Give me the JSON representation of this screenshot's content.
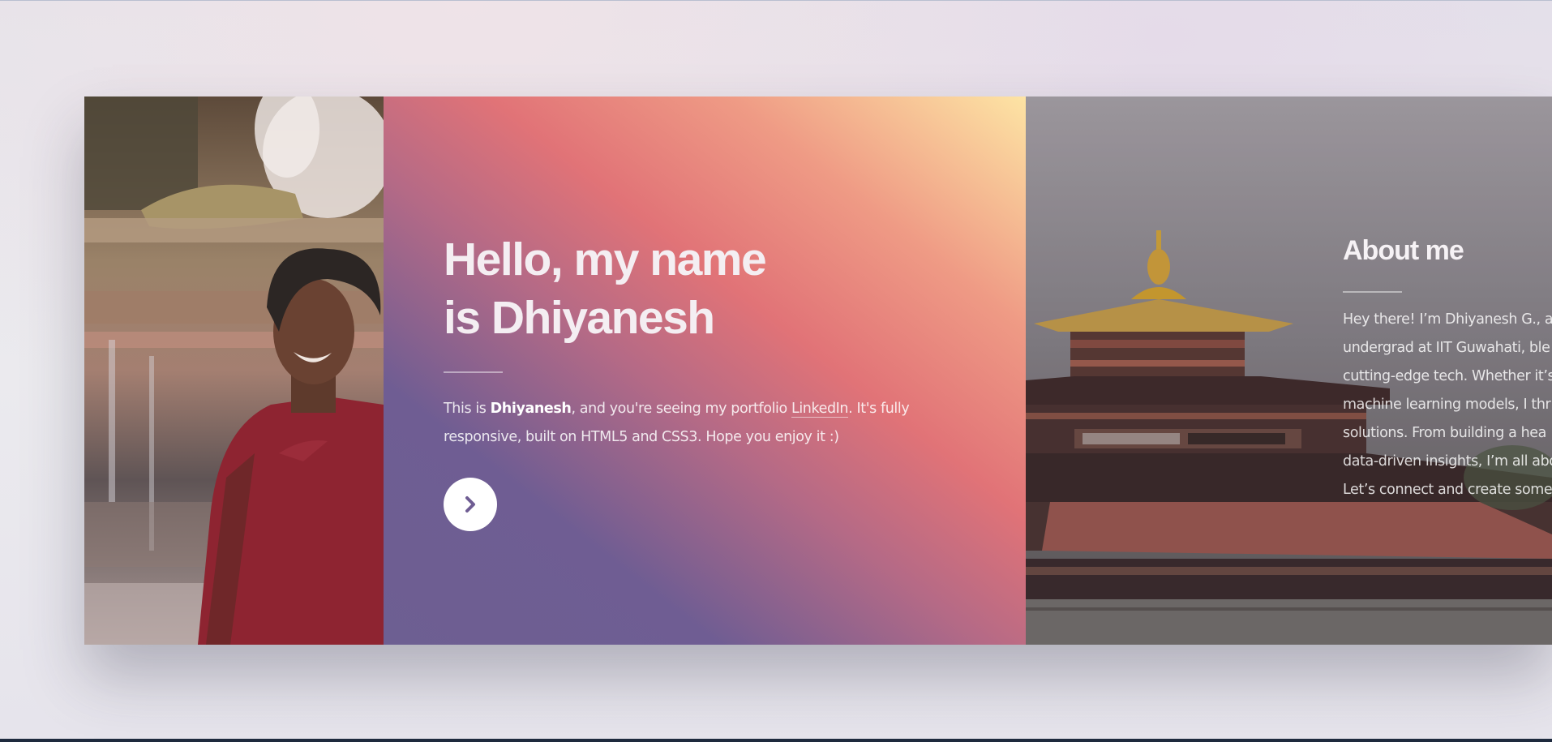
{
  "intro": {
    "title_line1": "Hello, my name",
    "title_line2": "is Dhiyanesh",
    "text_prefix": "This is ",
    "text_name": "Dhiyanesh",
    "text_middle": ", and you're seeing my portfolio ",
    "link_label": "LinkedIn",
    "text_suffix": ". It's fully responsive, built on HTML5 and CSS3. Hope you enjoy it :)",
    "next_icon": "chevron-right-icon"
  },
  "about": {
    "title": "About me",
    "lines": [
      "Hey there! I’m Dhiyanesh G., a",
      "undergrad at IIT Guwahati, ble",
      "cutting-edge tech. Whether it’s",
      "machine learning models, I thr",
      "solutions. From building a hea",
      "data-driven insights, I’m all abo",
      "Let’s connect and create some"
    ]
  },
  "colors": {
    "accent": "#ffffff",
    "gradient_start": "#6d5f92",
    "gradient_mid": "#e17377",
    "gradient_end": "#fde4a4",
    "button_icon": "#6f5d93"
  }
}
